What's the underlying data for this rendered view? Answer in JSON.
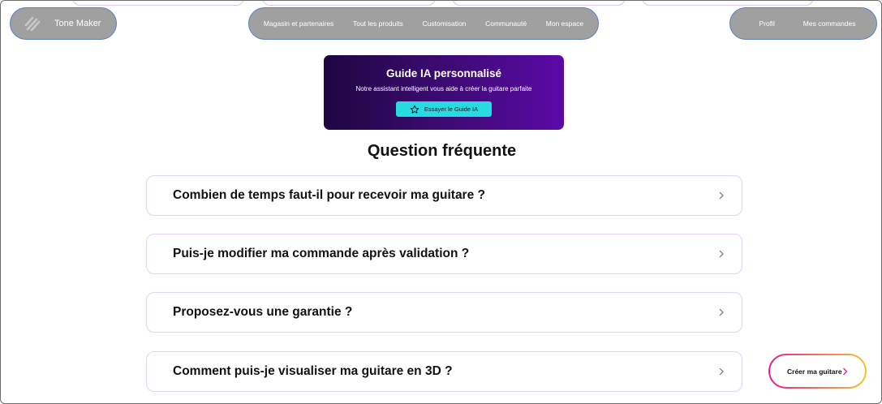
{
  "nav": {
    "brand": "Tone Maker",
    "links": [
      "Magasin et partenaires",
      "Tout les produits",
      "Customisation",
      "Communauté",
      "Mon espace"
    ],
    "account": [
      "Profil",
      "Mes commandes"
    ]
  },
  "banner": {
    "title": "Guide IA personnalisé",
    "subtitle": "Notre assistant intelligent vous aide à créer la guitare parfaite",
    "button": "Essayer le Guide IA"
  },
  "faq": {
    "title": "Question fréquente",
    "questions": [
      "Combien de temps faut-il pour recevoir ma guitare ?",
      "Puis-je modifier ma commande après validation ?",
      "Proposez-vous une garantie ?",
      "Comment puis-je visualiser ma guitare en 3D ?"
    ]
  },
  "cta": {
    "label": "Créer ma guitare"
  },
  "colors": {
    "nav_pill": "#a0a0a0",
    "nav_border": "#5b7fc1",
    "accent_button": "#27dbe0",
    "banner_start": "#1e0640",
    "banner_end": "#5a0aa6"
  },
  "icons": {
    "logo": "logo-icon",
    "star": "star-icon",
    "chevron": "chevron-right-icon"
  }
}
